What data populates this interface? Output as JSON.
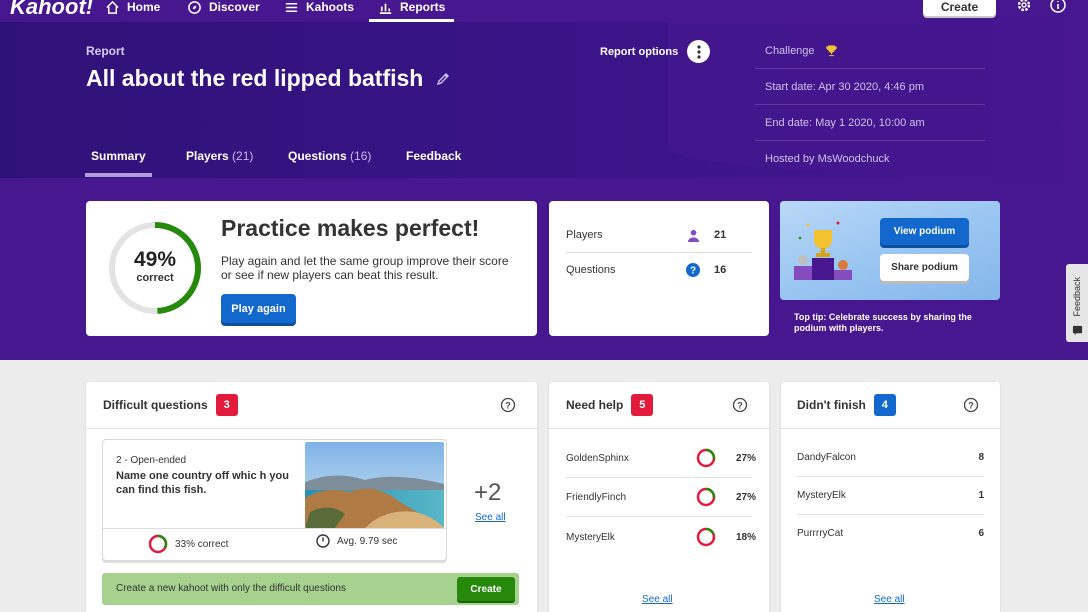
{
  "nav": {
    "logo": "Kahoot!",
    "items": [
      {
        "label": "Home",
        "icon": "home-icon"
      },
      {
        "label": "Discover",
        "icon": "compass-icon"
      },
      {
        "label": "Kahoots",
        "icon": "list-icon"
      },
      {
        "label": "Reports",
        "icon": "chart-icon",
        "active": true
      }
    ],
    "create_label": "Create"
  },
  "header": {
    "label": "Report",
    "title": "All about the red lipped batfish",
    "options_label": "Report options",
    "tabs": [
      {
        "label": "Summary",
        "count": ""
      },
      {
        "label": "Players",
        "count": "(21)"
      },
      {
        "label": "Questions",
        "count": "(16)"
      },
      {
        "label": "Feedback",
        "count": ""
      }
    ],
    "meta": {
      "mode": "Challenge",
      "start": "Start date: Apr 30 2020, 4:46 pm",
      "end": "End date: May 1 2020, 10:00 am",
      "host": "Hosted by MsWoodchuck"
    }
  },
  "practice": {
    "percent": "49%",
    "percent_value": 49,
    "percent_label": "correct",
    "title": "Practice makes perfect!",
    "text": "Play again and let the same group improve their score or see if new players can beat this result.",
    "button": "Play again"
  },
  "stats": {
    "players_label": "Players",
    "players_value": "21",
    "questions_label": "Questions",
    "questions_value": "16"
  },
  "podium": {
    "view_label": "View podium",
    "share_label": "Share podium",
    "tip": "Top tip: Celebrate success by sharing the podium with players."
  },
  "feedback_tab": "Feedback",
  "difficult": {
    "title": "Difficult questions",
    "count": "3",
    "question_type": "2 - Open-ended",
    "question_text": "Name one country off whic h you can find this fish.",
    "correct": "33% correct",
    "correct_value": 33,
    "avg": "Avg. 9.79 sec",
    "more": "+2",
    "see_all": "See all",
    "create_text": "Create a new kahoot with only the difficult questions",
    "create_button": "Create"
  },
  "need_help": {
    "title": "Need help",
    "count": "5",
    "rows": [
      {
        "name": "GoldenSphinx",
        "pct": "27%",
        "value": 27
      },
      {
        "name": "FriendlyFinch",
        "pct": "27%",
        "value": 27
      },
      {
        "name": "MysteryElk",
        "pct": "18%",
        "value": 18
      }
    ],
    "see_all": "See all"
  },
  "didnt_finish": {
    "title": "Didn't finish",
    "count": "4",
    "rows": [
      {
        "name": "DandyFalcon",
        "value": "8"
      },
      {
        "name": "MysteryElk",
        "value": "1"
      },
      {
        "name": "PurrrryCat",
        "value": "6"
      }
    ],
    "see_all": "See all"
  },
  "colors": {
    "brand_purple": "#46178f",
    "blue": "#1368ce",
    "red": "#e21b3c",
    "green": "#26890c"
  }
}
